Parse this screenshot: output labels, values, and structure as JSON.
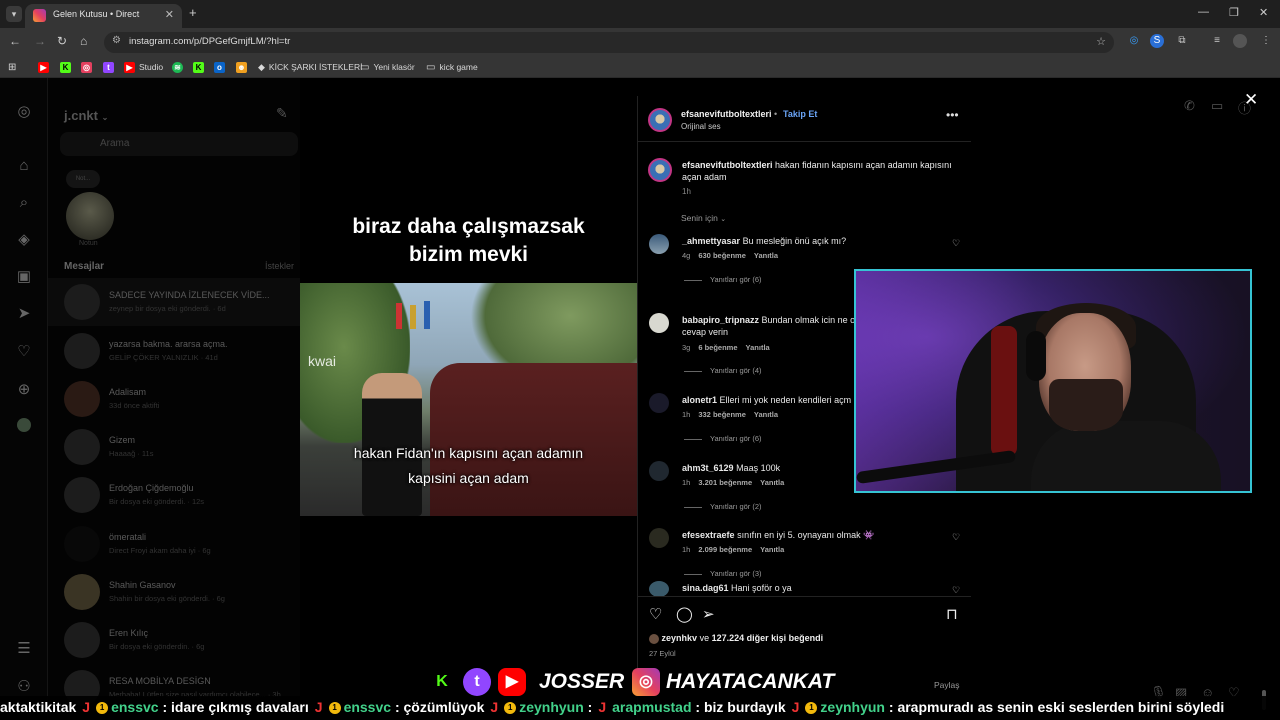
{
  "browser": {
    "tab_title": "Gelen Kutusu • Direct",
    "url": "instagram.com/p/DPGefGmjfLM/?hl=tr",
    "bookmarks": [
      {
        "label": "",
        "icon": "youtube-icon",
        "color": "#ff0000"
      },
      {
        "label": "",
        "icon": "kick-icon",
        "color": "#53fc18"
      },
      {
        "label": "",
        "icon": "instagram-icon",
        "color": "#e4405f"
      },
      {
        "label": "",
        "icon": "twitch-icon",
        "color": "#9146ff"
      },
      {
        "label": "Studio",
        "icon": "youtube-studio-icon",
        "color": "#ff0000"
      },
      {
        "label": "",
        "icon": "spotify-icon",
        "color": "#1db954"
      },
      {
        "label": "",
        "icon": "kick-icon",
        "color": "#53fc18"
      },
      {
        "label": "",
        "icon": "outlook-icon",
        "color": "#0a64c8"
      },
      {
        "label": "",
        "icon": "bookmark-icon",
        "color": "#f0a020"
      },
      {
        "label": "KİCK ŞARKI İSTEKLERİ",
        "icon": "kick-dark-icon",
        "color": "#ddd"
      },
      {
        "label": "Yeni klasör",
        "icon": "folder-icon",
        "color": "#ddd"
      },
      {
        "label": "kick game",
        "icon": "folder-icon",
        "color": "#ddd"
      }
    ]
  },
  "dm": {
    "username": "j.cnkt",
    "search_placeholder": "Arama",
    "note_bubble": "Not...",
    "note_label": "Notun",
    "messages_heading": "Mesajlar",
    "requests_label": "İstekler",
    "conversations": [
      {
        "name": "SADECE YAYINDA İZLENECEK VİDE...",
        "preview": "zeynep bir dosya eki gönderdi. · 6d"
      },
      {
        "name": "yazarsa bakma. ararsa açma.",
        "preview": "GELİP ÇÖKER YALNIZLIK · 41d"
      },
      {
        "name": "Adalisam",
        "preview": "33d önce aktifti"
      },
      {
        "name": "Gizem",
        "preview": "Haaaağ · 11s"
      },
      {
        "name": "Erdoğan Çiğdemoğlu",
        "preview": "Bir dosya eki gönderdi. · 12s"
      },
      {
        "name": "ömeratali",
        "preview": "Direct Froyi akam daha iyi · 6g"
      },
      {
        "name": "Shahin Gasanov",
        "preview": "Shahin bir dosya eki gönderdi. · 6g"
      },
      {
        "name": "Eren Kılıç",
        "preview": "Bir dosya eki gönderdin. · 6g"
      },
      {
        "name": "RESA MOBİLYA DESİGN",
        "preview": "Merhaba! Lütfen size nasıl yardımcı olabilece... · 3h"
      }
    ]
  },
  "video": {
    "top_caption_line1": "biraz daha çalışmazsak",
    "top_caption_line2": "bizim mevki",
    "watermark": "kwai",
    "subtitle_line1": "hakan Fidan'ın kapısını açan adamın",
    "subtitle_line2": "kapısini açan adam"
  },
  "post": {
    "username": "efsanevifutboltextleri",
    "dot": "•",
    "follow_label": "Takip Et",
    "audio": "Orijinal ses",
    "caption_user": "efsanevifutboltextleri",
    "caption_text": "hakan fidanın kapısını açan adamın kapısını açan adam",
    "caption_time": "1h",
    "sort_label": "Senin için",
    "comments": [
      {
        "user": "_ahmettyasar",
        "text": "Bu mesleğin önü açık mı?",
        "time": "4g",
        "likes": "630 beğenme",
        "reply": "Yanıtla",
        "replies": "Yanıtları gör (6)"
      },
      {
        "user": "babapiro_tripnazz",
        "text": "Bundan olmak icin ne o",
        "text2": "cevap verin",
        "time": "3g",
        "likes": "6 beğenme",
        "reply": "Yanıtla",
        "replies": "Yanıtları gör (4)"
      },
      {
        "user": "alonetr1",
        "text": "Elleri mi yok neden kendileri açm",
        "time": "1h",
        "likes": "332 beğenme",
        "reply": "Yanıtla",
        "replies": "Yanıtları gör (6)"
      },
      {
        "user": "ahm3t_6129",
        "text": "Maaş 100k",
        "time": "1h",
        "likes": "3.201 beğenme",
        "reply": "Yanıtla",
        "replies": "Yanıtları gör (2)"
      },
      {
        "user": "efesextraefe",
        "text": "sınıfın en iyi 5. oynayanı olmak 👾",
        "time": "1h",
        "likes": "2.099 beğenme",
        "reply": "Yanıtla",
        "replies": "Yanıtları gör (3)"
      },
      {
        "user": "sina.dag61",
        "text": "Hani şoför o ya"
      }
    ],
    "likes_prefix": "zeynhkv",
    "likes_mid": "ve",
    "likes_count": "127.224 diğer kişi",
    "likes_suffix": "beğendi",
    "date": "27 Eylül",
    "share_label": "Paylaş"
  },
  "stream": {
    "banner_name1": "JOSSER",
    "banner_name2": "HAYATACANKAT",
    "ticker": [
      {
        "user": "aktaktikitak",
        "msg": ""
      },
      {
        "user": "enssvc",
        "msg": ": idare çıkmış davaları"
      },
      {
        "user": "enssvc",
        "msg": ": çözümlüyok"
      },
      {
        "user": "zeynhyun",
        "msg": ":"
      },
      {
        "user": "arapmustad",
        "msg": ": biz burdayık"
      },
      {
        "user": "zeynhyun",
        "msg": ": arapmuradı as senin eski seslerden birini söyledi"
      }
    ]
  },
  "colors": {
    "follow_blue": "#6aa4f6",
    "webcam_border": "#36c4d4",
    "ticker_user": "#42d18a"
  }
}
